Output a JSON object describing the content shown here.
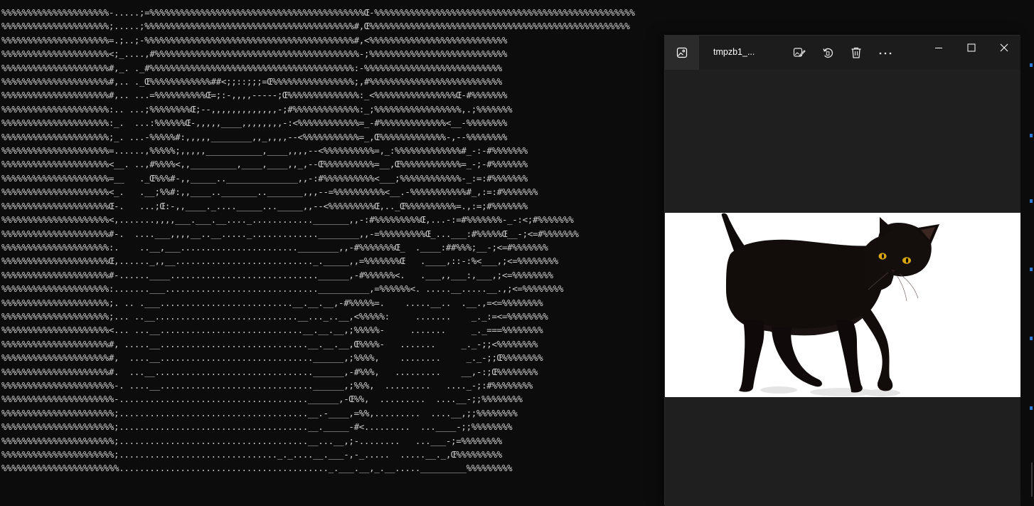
{
  "terminal": {
    "ascii_lines": [
      "%%%%%%%%%%%%%%%%%%%%%-.....;=%%%%%%%%%%%%%%%%%%%%%%%%%%%%%%%%%%%%%%%%%%Œ-%%%%%%%%%%%%%%%%%%%%%%%%%%%%%%%%%%%%%%%%%%%%%%%%%%%",
      "%%%%%%%%%%%%%%%%%%%%%;.....;%%%%%%%%%%%%%%%%%%%%%%%%%%%%%%%%%%%%%%%%%#,Œ%%%%%%%%%%%%%%%%%%%%%%%%%%%%%%%%%%%%%%%%%%%%%%%%%%%",
      "%%%%%%%%%%%%%%%%%%%%%=.;..;-%%%%%%%%%%%%%%%%%%%%%%%%%%%%%%%%%%%%%%%%%#,<%%%%%%%%%%%%%%%%%%%%%%%%%%%",
      "%%%%%%%%%%%%%%%%%%%%%<;_....,#%%%%%%%%%%%%%%%%%%%%%%%%%%%%%%%%%%%%%%%%-;%%%%%%%%%%%%%%%%%%%%%%%%%%%",
      "%%%%%%%%%%%%%%%%%%%%%#,_. ._#%%%%%%%%%%%%%%%%%%%%%%%%%%%%%%%%%%%%%%%%:-%%%%%%%%%%%%%%%%%%%%%%%%%%%",
      "%%%%%%%%%%%%%%%%%%%%%#,.. ._Œ%%%%%%%%%%%%##<;;::;;;=Œ%%%%%%%%%%%%%%%%;,#%%%%%%%%%%%%%%%%%%%%%%%%%%",
      "%%%%%%%%%%%%%%%%%%%%%#,.. ...=%%%%%%%%%%Œ=;:-,,,,-----;Œ%%%%%%%%%%%%%%:_<%%%%%%%%%%%%%%%%Œ-#%%%%%%%",
      "%%%%%%%%%%%%%%%%%%%%%:.. ...;%%%%%%%%Œ;--,,,,,,,,,,,,,-;#%%%%%%%%%%%%%:_;%%%%%%%%%%%%%%%%%,.;%%%%%%%",
      "%%%%%%%%%%%%%%%%%%%%%:_.  ...:%%%%%%Œ-,,,,,____,,,,,,,,-:<%%%%%%%%%%%%=_-#%%%%%%%%%%%%%<__-%%%%%%%%",
      "%%%%%%%%%%%%%%%%%%%%%;_. ...-%%%%%#:,,,,,________,,_,,,,--<%%%%%%%%%%%=_,Œ%%%%%%%%%%%%%-,--%%%%%%%%",
      "%%%%%%%%%%%%%%%%%%%%%=......,%%%%%;,,,,,___________,____,,,,--<%%%%%%%%%%=,_:%%%%%%%%%%%%%#_-:-#%%%%%%%",
      "%%%%%%%%%%%%%%%%%%%%%<__. ..,#%%%%<,,_________,____,____,,_,--Œ%%%%%%%%%%=__,Œ%%%%%%%%%%%%=_-;-#%%%%%%%",
      "%%%%%%%%%%%%%%%%%%%%%=__   ._Œ%%%#-,,_____..______________,,-:#%%%%%%%%%%<___;%%%%%%%%%%%%-_:=:#%%%%%%%",
      "%%%%%%%%%%%%%%%%%%%%%<_.   .__;%%#:,,____.._______.._______,,,--=%%%%%%%%%%<__.-%%%%%%%%%%%#_,:=:#%%%%%%%",
      "%%%%%%%%%%%%%%%%%%%%%Œ-.   ...;Œ:-,,____._...._____..._____,,--<%%%%%%%%%Œ,.._Œ%%%%%%%%%%=.,:=;#%%%%%%%",
      "%%%%%%%%%%%%%%%%%%%%%<,.......,,,,___.___.__...._............_______,,-:#%%%%%%%%%Œ,...-:=#%%%%%%%-_-:<;#%%%%%%%",
      "%%%%%%%%%%%%%%%%%%%%%#-.  ....___,,,,__..__....._.............________,,-=%%%%%%%%%Œ_...___:#%%%%%Œ__-;<=#%%%%%%%",
      "%%%%%%%%%%%%%%%%%%%%%:.    ..__,___.......................________,,-#%%%%%%%Œ_  .____:##%%%;__-;<=#%%%%%%%",
      "%%%%%%%%%%%%%%%%%%%%%Œ,......_,,__..........................._._____,,=%%%%%%%Œ   .____,::-:%<___,;<=%%%%%%%%",
      "%%%%%%%%%%%%%%%%%%%%%#-......____.............................______,-#%%%%%%<.   .___,,___:,___,;<=%%%%%%%%",
      "%%%%%%%%%%%%%%%%%%%%%:.......___..............................__________,=%%%%%%<. .....__.....__.,;<=%%%%%%%%",
      "%%%%%%%%%%%%%%%%%%%%%;. .. .___..........................__.__.__,-#%%%%%=.    .....__..  .__.,=<=%%%%%%%%",
      "%%%%%%%%%%%%%%%%%%%%%;... ..__............................__..._..__,<%%%%%:     .......    _._:=<=%%%%%%%%",
      "%%%%%%%%%%%%%%%%%%%%%<... ...__............................__.__.__,;%%%%%-     .......     _._===%%%%%%%%",
      "%%%%%%%%%%%%%%%%%%%%%#, .....__.............................__.__.__,Œ%%%%-   .......     _._-;;<%%%%%%%%",
      "%%%%%%%%%%%%%%%%%%%%%#,  ....__..............................______,;%%%%,    ........     _._-;;Œ%%%%%%%%",
      "%%%%%%%%%%%%%%%%%%%%%#.  ...__...............................______,-#%%%,   .........    __,-:;Œ%%%%%%%%",
      "%%%%%%%%%%%%%%%%%%%%%%-. ....__..............................______,;%%%,  .........   ...._-;:#%%%%%%%%",
      "%%%%%%%%%%%%%%%%%%%%%%-.....................................______,-Œ%%,  .........  ....__-;;%%%%%%%%",
      "%%%%%%%%%%%%%%%%%%%%%%;.....................................__.-____,=%%,.........  ....__,;;%%%%%%%%",
      "%%%%%%%%%%%%%%%%%%%%%%;.....................................__._____-#<.........  ...____-;;%%%%%%%%",
      "%%%%%%%%%%%%%%%%%%%%%%;.....................................__...__,;-........   ...___-;=%%%%%%%%",
      "%%%%%%%%%%%%%%%%%%%%%%;..............................._._....__.___-,-_.....  .....__._,Œ%%%%%%%%%",
      "%%%%%%%%%%%%%%%%%%%%%%%........................................._.___.__,_.__....._________%%%%%%%%%"
    ]
  },
  "viewer": {
    "title": "tmpzb1_...",
    "icons": {
      "app": "image-icon",
      "edit": "edit-image-icon",
      "rotate": "rotate-icon",
      "delete": "trash-icon",
      "more": "more-icon",
      "minimize": "minimize-icon",
      "maximize": "maximize-icon",
      "close": "close-icon"
    },
    "photo": {
      "subject": "black cat",
      "background": "#ffffff"
    }
  },
  "colors": {
    "terminal_bg": "#0c0c0c",
    "terminal_fg": "#cccccc",
    "viewer_bg": "#1f1f1f",
    "titlebar_bg": "#1c1c1c",
    "accent": "#2f7bd6"
  }
}
